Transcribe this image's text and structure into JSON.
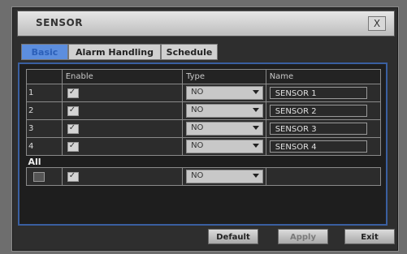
{
  "window": {
    "title": "SENSOR",
    "close_label": "X"
  },
  "tabs": [
    {
      "label": "Basic",
      "active": true
    },
    {
      "label": "Alarm Handling",
      "active": false
    },
    {
      "label": "Schedule",
      "active": false
    }
  ],
  "table": {
    "headers": [
      "",
      "Enable",
      "Type",
      "Name"
    ],
    "rows": [
      {
        "index": "1",
        "enabled": true,
        "type": "NO",
        "name": "SENSOR 1"
      },
      {
        "index": "2",
        "enabled": true,
        "type": "NO",
        "name": "SENSOR 2"
      },
      {
        "index": "3",
        "enabled": true,
        "type": "NO",
        "name": "SENSOR 3"
      },
      {
        "index": "4",
        "enabled": true,
        "type": "NO",
        "name": "SENSOR 4"
      }
    ],
    "all_label": "All",
    "all_row": {
      "select_all": false,
      "enabled": true,
      "type": "NO"
    }
  },
  "buttons": {
    "default": "Default",
    "apply": "Apply",
    "exit": "Exit"
  },
  "colors": {
    "active_tab": "#5c8ede",
    "panel_border": "#3a5fa0"
  }
}
